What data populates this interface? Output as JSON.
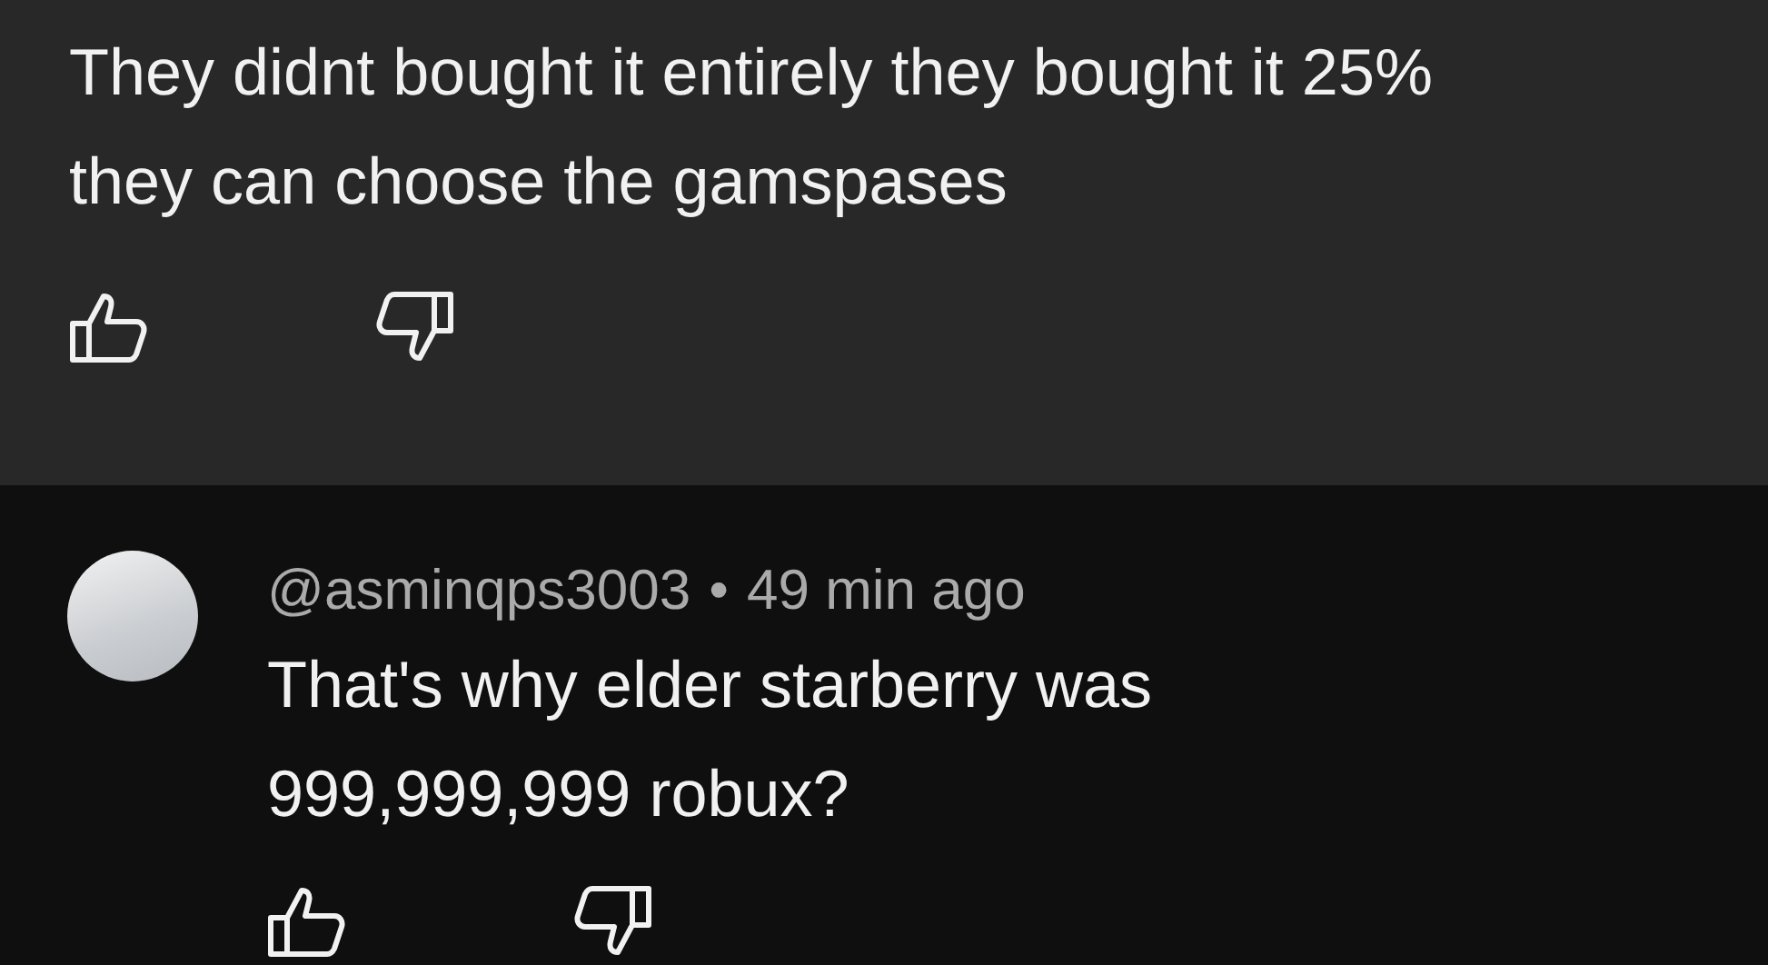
{
  "comments": [
    {
      "text": "They didnt bought it entirely they bought it 25% they can choose the gamspases",
      "highlighted": true
    },
    {
      "author": "@asminqps3003",
      "separator": "•",
      "time": "49 min ago",
      "text": "That's why elder starberry was 999,999,999 robux?",
      "highlighted": false
    }
  ]
}
